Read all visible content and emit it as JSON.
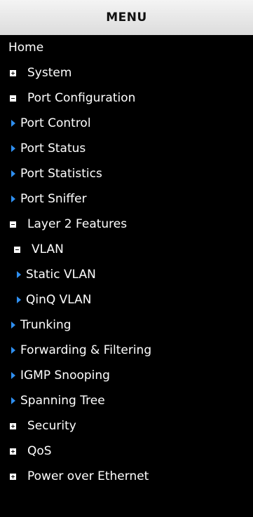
{
  "header": {
    "title": "MENU"
  },
  "menu": {
    "home": "Home",
    "system": "System",
    "port_configuration": "Port Configuration",
    "port_control": "Port Control",
    "port_status": "Port Status",
    "port_statistics": "Port Statistics",
    "port_sniffer": "Port Sniffer",
    "layer2_features": "Layer 2 Features",
    "vlan": "VLAN",
    "static_vlan": "Static VLAN",
    "qinq_vlan": "QinQ VLAN",
    "trunking": "Trunking",
    "forwarding_filtering": "Forwarding & Filtering",
    "igmp_snooping": "IGMP Snooping",
    "spanning_tree": "Spanning Tree",
    "security": "Security",
    "qos": "QoS",
    "power_over_ethernet": "Power over Ethernet"
  },
  "colors": {
    "background": "#000000",
    "arrow": "#2f8ff0",
    "header_bg": "#e8e8e8"
  },
  "icons": {
    "collapsed": "plus-box-icon",
    "expanded": "minus-box-icon",
    "leaf": "triangle-right-icon"
  }
}
